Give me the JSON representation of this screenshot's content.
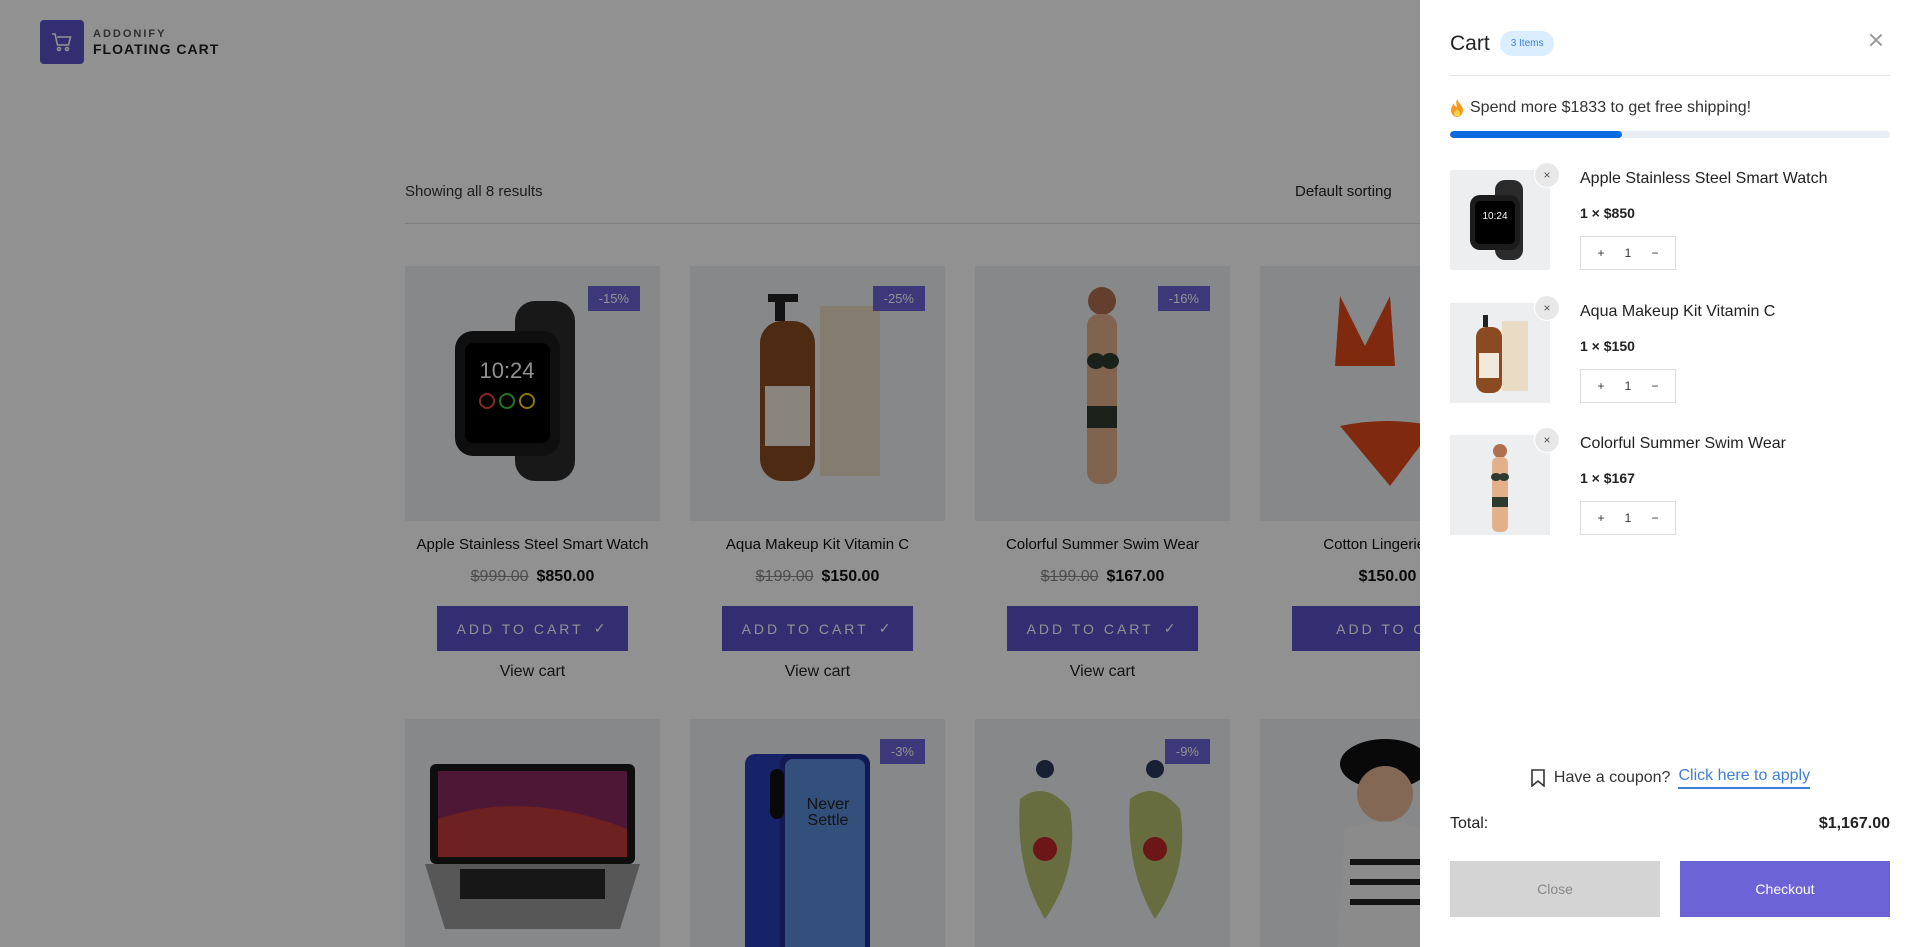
{
  "brand": {
    "top": "ADDONIFY",
    "bottom": "FLOATING CART",
    "color": "#5b52c8"
  },
  "shop": {
    "results_text": "Showing all 8 results",
    "sorting_label": "Default sorting",
    "products": [
      {
        "name": "Apple Stainless Steel Smart Watch",
        "old_price": "$999.00",
        "price": "$850.00",
        "badge": "-15%",
        "button": "ADD TO CART",
        "view_cart": "View cart"
      },
      {
        "name": "Aqua Makeup Kit Vitamin C",
        "old_price": "$199.00",
        "price": "$150.00",
        "badge": "-25%",
        "button": "ADD TO CART",
        "view_cart": "View cart"
      },
      {
        "name": "Colorful Summer Swim Wear",
        "old_price": "$199.00",
        "price": "$167.00",
        "badge": "-16%",
        "button": "ADD TO CART",
        "view_cart": ""
      },
      {
        "name": "Cotton Lingerie For",
        "old_price": "",
        "price": "$150.00",
        "badge": "",
        "button": "ADD TO CA",
        "view_cart": ""
      },
      {
        "name": "",
        "old_price": "",
        "price": "",
        "badge": "",
        "button": "",
        "view_cart": ""
      },
      {
        "name": "",
        "old_price": "",
        "price": "",
        "badge": "-3%",
        "button": "",
        "view_cart": ""
      },
      {
        "name": "",
        "old_price": "",
        "price": "",
        "badge": "-9%",
        "button": "",
        "view_cart": ""
      },
      {
        "name": "",
        "old_price": "",
        "price": "",
        "badge": "",
        "button": "",
        "view_cart": ""
      }
    ]
  },
  "cart": {
    "title": "Cart",
    "items_badge": "3 Items",
    "shipping_message": "Spend more $1833 to get free shipping!",
    "shipping_progress_fraction": 0.39,
    "items": [
      {
        "name": "Apple Stainless Steel Smart Watch",
        "qty_price": "1 × $850",
        "qty": "1",
        "plus": "+",
        "minus": "−",
        "remove": "×"
      },
      {
        "name": "Aqua Makeup Kit Vitamin C",
        "qty_price": "1 × $150",
        "qty": "1",
        "plus": "+",
        "minus": "−",
        "remove": "×"
      },
      {
        "name": "Colorful Summer Swim Wear",
        "qty_price": "1 × $167",
        "qty": "1",
        "plus": "+",
        "minus": "−",
        "remove": "×"
      }
    ],
    "coupon_text": "Have a coupon?",
    "coupon_link": "Click here to apply",
    "total_label": "Total:",
    "total_value": "$1,167.00",
    "close_button": "Close",
    "checkout_button": "Checkout",
    "accent_color": "#6c63d6",
    "progress_color": "#0b69e0"
  }
}
